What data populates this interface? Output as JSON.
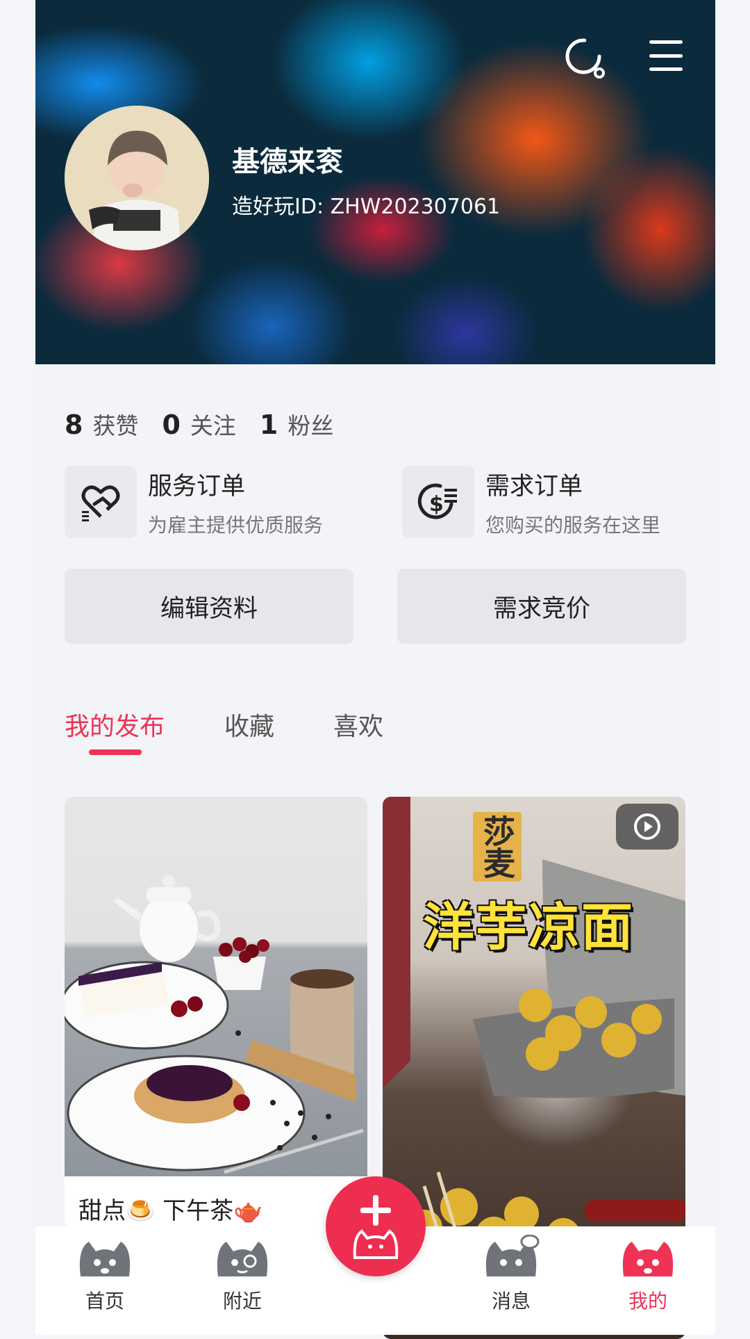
{
  "profile": {
    "nickname": "基德来衮",
    "user_id": "造好玩ID: ZHW202307061"
  },
  "stats": [
    {
      "num": "8",
      "label": "获赞"
    },
    {
      "num": "0",
      "label": "关注"
    },
    {
      "num": "1",
      "label": "粉丝"
    }
  ],
  "orders": {
    "service": {
      "title": "服务订单",
      "subtitle": "为雇主提供优质服务",
      "icon": "heart-hand-icon"
    },
    "demand": {
      "title": "需求订单",
      "subtitle": "您购买的服务在这里",
      "icon": "dollar-list-icon"
    }
  },
  "buttons": {
    "edit_profile": "编辑资料",
    "bidding": "需求竞价"
  },
  "tabs": [
    {
      "label": "我的发布",
      "active": true
    },
    {
      "label": "收藏",
      "active": false
    },
    {
      "label": "喜欢",
      "active": false
    }
  ],
  "feed": [
    {
      "title": "甜点🍮 下午茶🫖",
      "image": "dessert-photo"
    },
    {
      "overlay_text": "洋芋凉面",
      "sticker": "莎麦",
      "image": "street-food-photo",
      "is_video": true
    }
  ],
  "bottom_nav": [
    {
      "label": "首页",
      "active": false
    },
    {
      "label": "附近",
      "active": false
    },
    {
      "label": "消息",
      "active": false
    },
    {
      "label": "我的",
      "active": true
    }
  ],
  "colors": {
    "accent": "#ee3355",
    "fab": "#ee2e50",
    "button_bg": "#e6e7ea"
  }
}
